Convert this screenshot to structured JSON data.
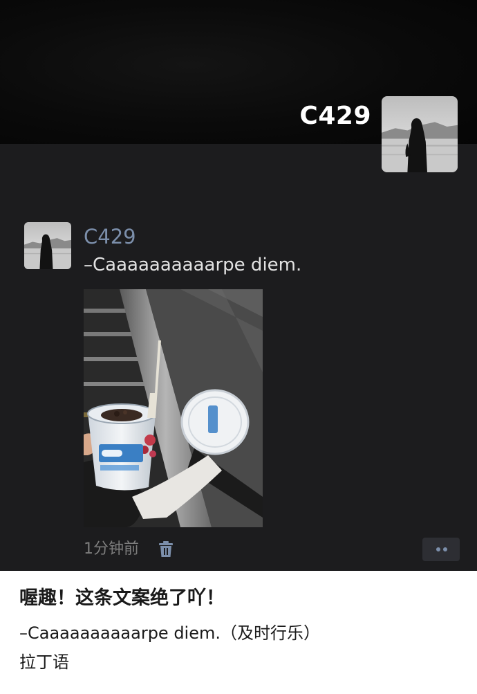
{
  "cover": {
    "display_name": "C429"
  },
  "post": {
    "author": "C429",
    "text": "–Caaaaaaaaaarpe diem.",
    "time": "1分钟前",
    "photo_icon": "photo-image",
    "delete_icon": "trash-icon",
    "more_icon": "more-dots-icon"
  },
  "caption": {
    "title": "喔趣！这条文案绝了吖！",
    "line": "–Caaaaaaaaaarpe diem.（及时行乐）",
    "note": "拉丁语"
  },
  "colors": {
    "background_dark": "#1c1c1e",
    "author_name": "#7c8fab",
    "time_text": "#7d7d7d",
    "caption_bg": "#ffffff"
  }
}
